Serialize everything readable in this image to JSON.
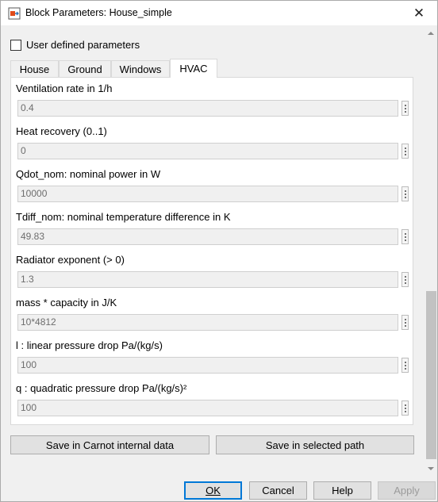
{
  "window": {
    "title": "Block Parameters: House_simple",
    "close_glyph": "✕",
    "icon": "simulink-block-icon"
  },
  "user_defined": {
    "label": "User defined parameters",
    "checked": false
  },
  "tabs": [
    {
      "label": "House",
      "active": false
    },
    {
      "label": "Ground",
      "active": false
    },
    {
      "label": "Windows",
      "active": false
    },
    {
      "label": "HVAC",
      "active": true
    }
  ],
  "fields": [
    {
      "label": "Ventilation rate in 1/h",
      "value": "0.4"
    },
    {
      "label": "Heat recovery (0..1)",
      "value": "0"
    },
    {
      "label": "Qdot_nom: nominal power in W",
      "value": "10000"
    },
    {
      "label": "Tdiff_nom: nominal temperature difference in K",
      "value": "49.83"
    },
    {
      "label": "Radiator exponent (> 0)",
      "value": "1.3"
    },
    {
      "label": "mass * capacity in J/K",
      "value": "10*4812"
    },
    {
      "label": "l : linear pressure drop Pa/(kg/s)",
      "value": "100"
    },
    {
      "label": "q : quadratic pressure drop Pa/(kg/s)²",
      "value": "100"
    }
  ],
  "actions": {
    "save_internal": "Save in Carnot internal data",
    "save_selected": "Save in selected path"
  },
  "buttons": {
    "ok": "OK",
    "cancel": "Cancel",
    "help": "Help",
    "apply": "Apply"
  },
  "colors": {
    "accent": "#0078d7",
    "panel": "#ffffff",
    "dialog": "#f0f0f0"
  }
}
